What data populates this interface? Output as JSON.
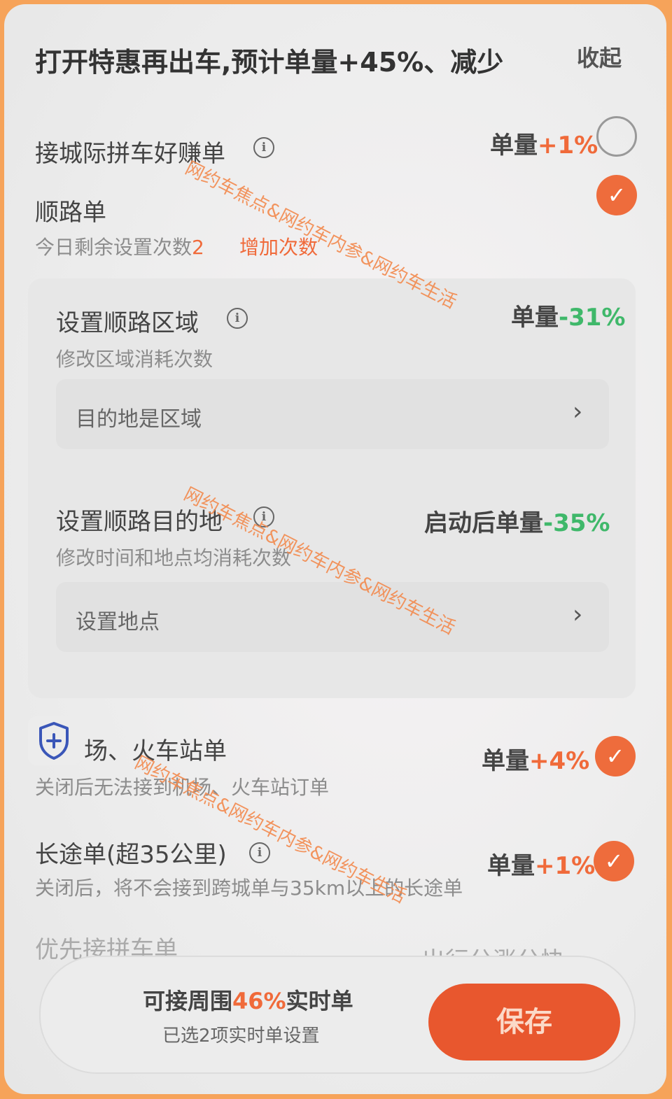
{
  "header": {
    "title": "打开特惠再出车,预计单量+45%、减少",
    "collapse_label": "收起"
  },
  "intercity": {
    "label": "接城际拼车好赚单",
    "pct_prefix": "单量",
    "pct_value": "+1%",
    "checked": false
  },
  "route_order": {
    "label": "顺路单",
    "remaining_label": "今日剩余设置次数",
    "remaining_count": "2",
    "increase_label": "增加次数",
    "checked": true
  },
  "route_area": {
    "label": "设置顺路区域",
    "sub": "修改区域消耗次数",
    "pct_prefix": "单量",
    "pct_value": "-31%",
    "field_text": "目的地是区域"
  },
  "route_destination": {
    "label": "设置顺路目的地",
    "sub": "修改时间和地点均消耗次数",
    "pct_prefix": "启动后单量",
    "pct_value": "-35%",
    "field_text": "设置地点"
  },
  "airport": {
    "label": "场、火车站单",
    "sub": "关闭后无法接到机场、火车站订单",
    "pct_prefix": "单量",
    "pct_value": "+4%",
    "checked": true
  },
  "long_distance": {
    "label": "长途单(超35公里)",
    "sub": "关闭后，将不会接到跨城单与35km以上的长途单",
    "pct_prefix": "单量",
    "pct_value": "+1%",
    "checked": true
  },
  "priority_carpool": {
    "label": "优先接拼车单",
    "right_text": "出行分涨分快"
  },
  "bottom": {
    "summary_prefix": "可接周围",
    "summary_pct": "46%",
    "summary_suffix": "实时单",
    "selected_text": "已选2项实时单设置",
    "save_label": "保存"
  },
  "watermark": "网约车焦点&网约车内参&网约车生活",
  "colors": {
    "accent": "#ee6c3c",
    "increase": "#f06a3a",
    "decrease": "#3fb86a",
    "frame": "#f6a35a"
  }
}
